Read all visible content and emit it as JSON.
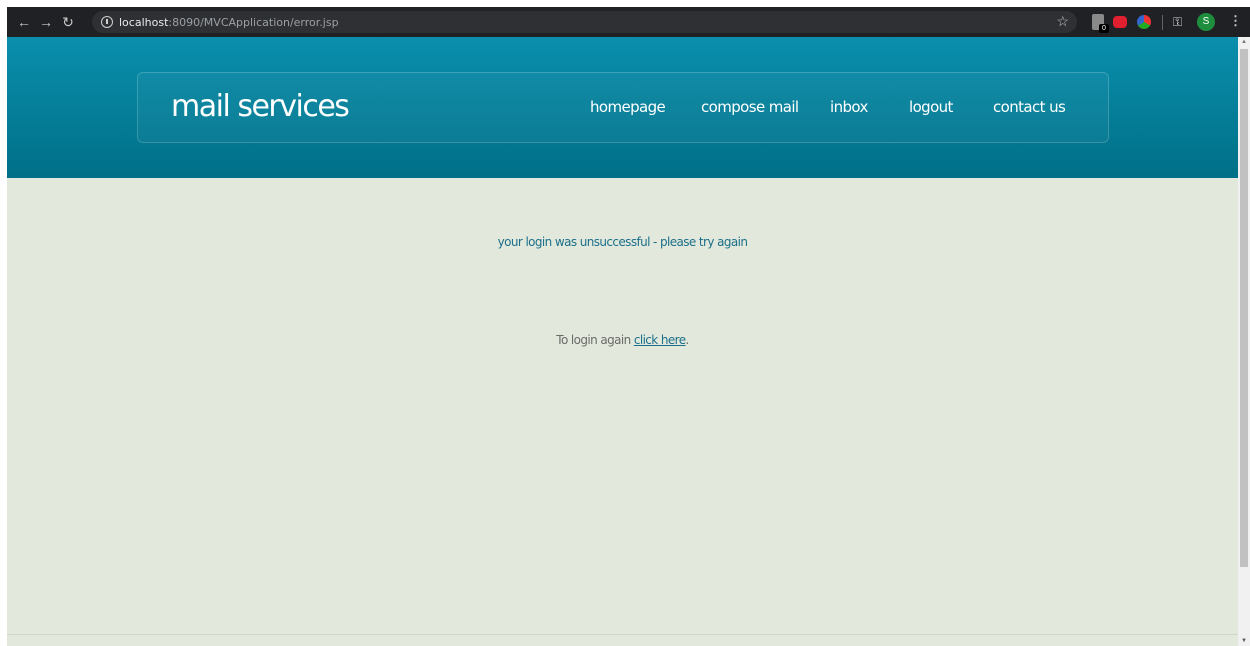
{
  "browser": {
    "url_host": "localhost",
    "url_path": ":8090/MVCApplication/error.jsp",
    "extension_badge": "0",
    "profile_initial": "S",
    "icons": [
      "back-arrow-icon",
      "forward-arrow-icon",
      "reload-icon",
      "info-icon",
      "star-icon",
      "key-icon",
      "menu-dots-icon"
    ]
  },
  "header": {
    "logo": "mail services",
    "nav": [
      {
        "label": "homepage"
      },
      {
        "label": "compose mail"
      },
      {
        "label": "inbox"
      },
      {
        "label": "logout"
      },
      {
        "label": "contact us"
      }
    ]
  },
  "main": {
    "error_message": "your login was unsuccessful - please try again",
    "relogin_prefix": "To login again ",
    "relogin_link": "click here",
    "relogin_suffix": "."
  },
  "colors": {
    "header_top": "#0a8fad",
    "header_bottom": "#006f87",
    "background": "#e2e9dc",
    "accent_text": "#1c6f8a"
  }
}
